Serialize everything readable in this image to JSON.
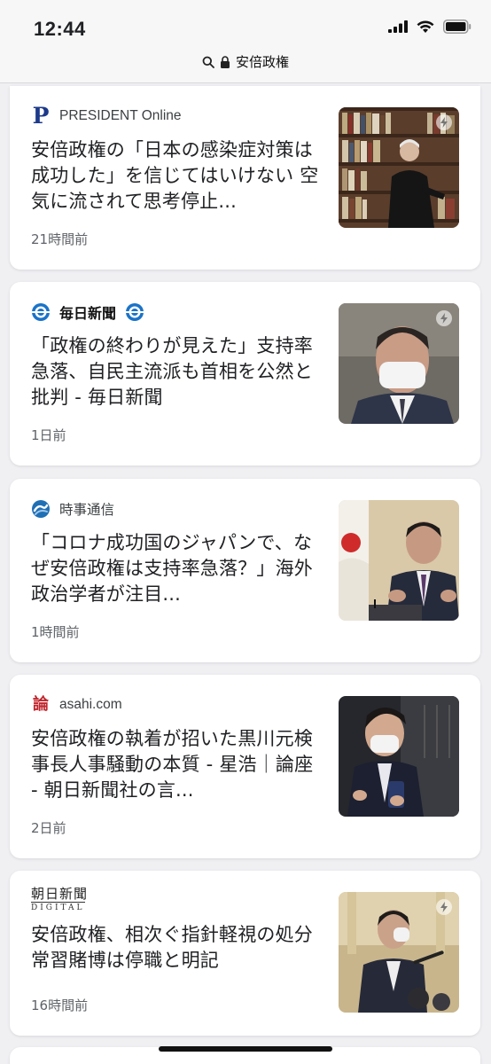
{
  "status_bar": {
    "time": "12:44"
  },
  "address_bar": {
    "text": "安倍政権"
  },
  "articles": [
    {
      "source": "PRESIDENT Online",
      "source_logo": "P",
      "headline": "安倍政権の「日本の感染症対策は成功した」を信じてはいけない 空気に流されて思考停止...",
      "time_ago": "21時間前"
    },
    {
      "source": "毎日新聞",
      "headline": "「政権の終わりが見えた」支持率急落、自民主流派も首相を公然と批判 - 毎日新聞",
      "time_ago": "1日前"
    },
    {
      "source": "時事通信",
      "headline": "「コロナ成功国のジャパンで、なぜ安倍政権は支持率急落？」海外政治学者が注目...",
      "time_ago": "1時間前"
    },
    {
      "source": "asahi.com",
      "source_logo": "論",
      "headline": "安倍政権の執着が招いた黒川元検事長人事騒動の本質 - 星浩｜論座 - 朝日新聞社の言...",
      "time_ago": "2日前"
    },
    {
      "source": "朝日新聞",
      "source_sub": "DIGITAL",
      "headline": "安倍政権、相次ぐ指針軽視の処分 常習賭博は停職と明記",
      "time_ago": "16時間前"
    }
  ],
  "icons": {
    "amp": "lightning-icon",
    "lock": "lock-icon",
    "search": "search-icon"
  },
  "colors": {
    "president_blue": "#1d3a8a",
    "mainichi_blue": "#1a73c8",
    "jiji_blue": "#1f6fb5",
    "asahi_red": "#c0272d"
  }
}
